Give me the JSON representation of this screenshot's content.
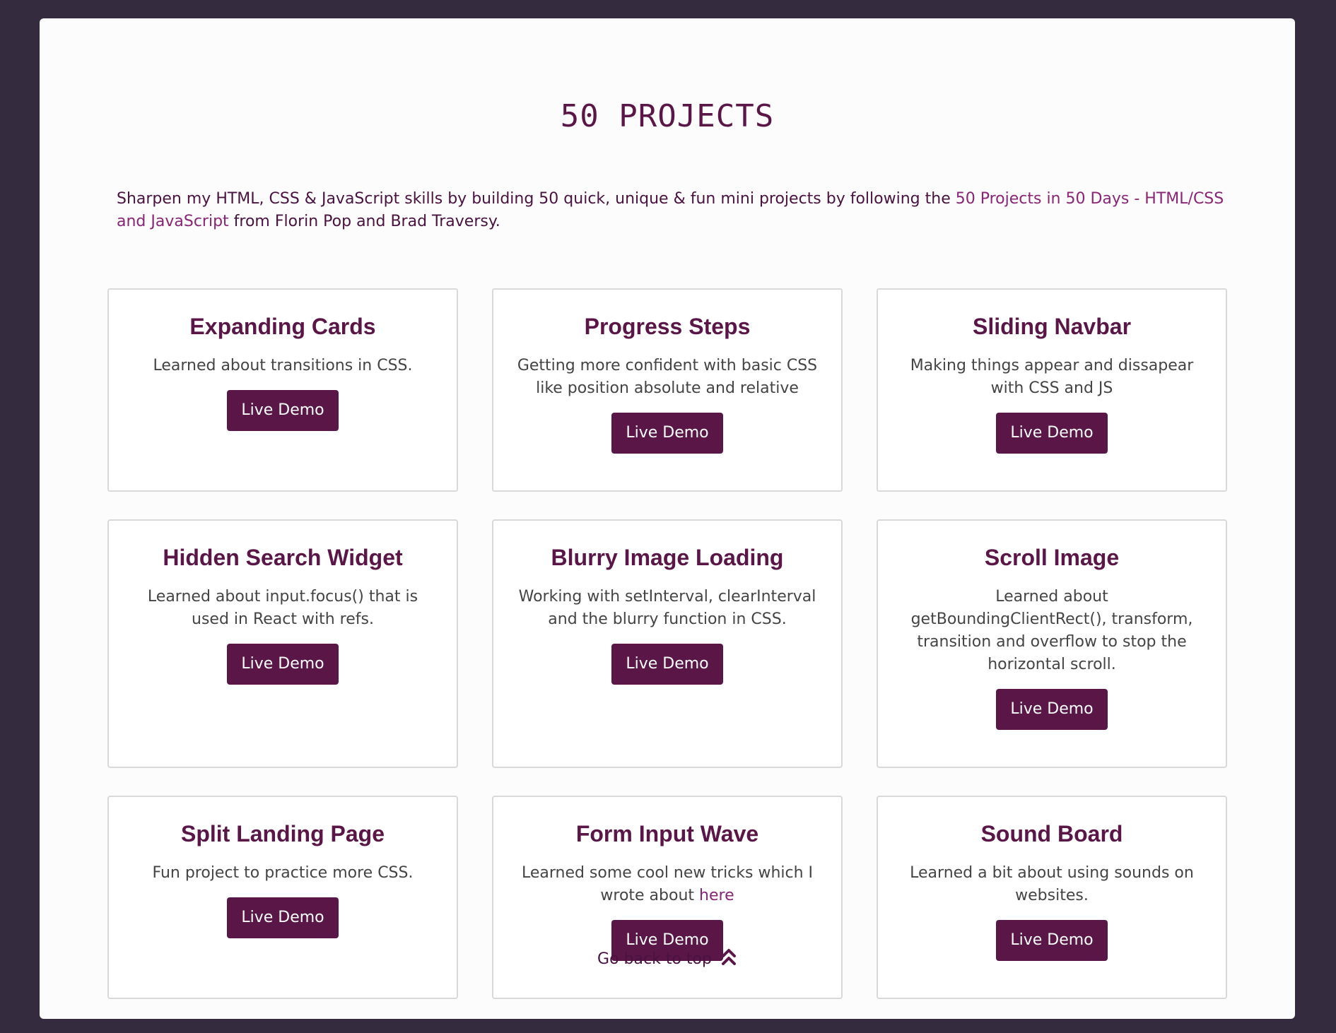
{
  "header": {
    "title": "50 PROJECTS"
  },
  "intro": {
    "text_before": "Sharpen my HTML, CSS & JavaScript skills by building 50 quick, unique & fun mini projects by following the ",
    "link_text": "50 Projects in 50 Days - HTML/CSS and JavaScript",
    "text_after": " from Florin Pop and Brad Traversy."
  },
  "projects": [
    {
      "title": "Expanding Cards",
      "description": "Learned about transitions in CSS.",
      "button": "Live Demo"
    },
    {
      "title": "Progress Steps",
      "description": "Getting more confident with basic CSS like position absolute and relative",
      "button": "Live Demo"
    },
    {
      "title": "Sliding Navbar",
      "description": "Making things appear and dissapear with CSS and JS",
      "button": "Live Demo"
    },
    {
      "title": "Hidden Search Widget",
      "description": "Learned about input.focus() that is used in React with refs.",
      "button": "Live Demo"
    },
    {
      "title": "Blurry Image Loading",
      "description": "Working with setInterval, clearInterval and the blurry function in CSS.",
      "button": "Live Demo"
    },
    {
      "title": "Scroll Image",
      "description": "Learned about getBoundingClientRect(), transform, transition and overflow to stop the horizontal scroll.",
      "button": "Live Demo"
    },
    {
      "title": "Split Landing Page",
      "description": "Fun project to practice more CSS.",
      "button": "Live Demo"
    },
    {
      "title": "Form Input Wave",
      "description": "Learned some cool new tricks which I wrote about ",
      "link": "here",
      "button": "Live Demo"
    },
    {
      "title": "Sound Board",
      "description": "Learned a bit about using sounds on websites.",
      "button": "Live Demo"
    }
  ],
  "footer": {
    "back_to_top": "Go back to top",
    "icon": "chevrons-up-icon"
  },
  "colors": {
    "background": "#352b3e",
    "panel": "#fcfcfc",
    "accent": "#5a1646",
    "link": "#8a2576",
    "card_border": "#d9d9d9"
  }
}
